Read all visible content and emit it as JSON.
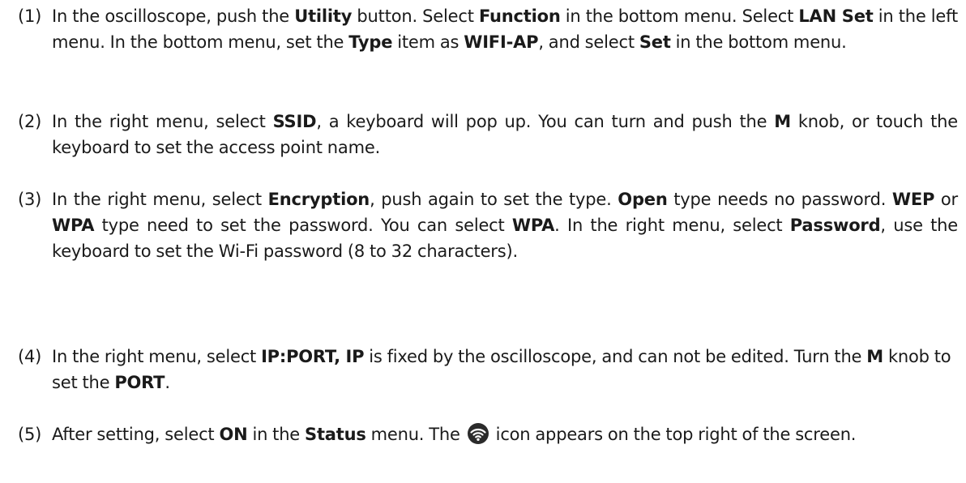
{
  "steps": [
    {
      "num": "(1)",
      "parts": [
        "In the oscilloscope, push the ",
        {
          "b": "Utility"
        },
        " button. Select ",
        {
          "b": "Function"
        },
        " in the bottom menu. Select ",
        {
          "b": "LAN Set"
        },
        " in the left menu. In the bottom menu, set the ",
        {
          "b": "Type"
        },
        " item as ",
        {
          "b": "WIFI-AP"
        },
        ", and select ",
        {
          "b": "Set"
        },
        " in the bottom menu."
      ]
    },
    {
      "num": "(2)",
      "parts": [
        "In the right menu, select ",
        {
          "b": "SSID"
        },
        ", a keyboard will pop up. You can turn and push the ",
        {
          "b": "M"
        },
        " knob, or touch the keyboard to set the access point name."
      ]
    },
    {
      "num": "(3)",
      "parts": [
        "In the right menu, select ",
        {
          "b": "Encryption"
        },
        ", push again to set the type. ",
        {
          "b": "Open"
        },
        " type needs no password. ",
        {
          "b": "WEP"
        },
        " or ",
        {
          "b": "WPA"
        },
        " type need to set the password. You can select ",
        {
          "b": "WPA"
        },
        ". In the right menu, select ",
        {
          "b": "Password"
        },
        ", use the keyboard to set the Wi-Fi password (8 to 32 characters)."
      ]
    },
    {
      "num": "(4)",
      "parts": [
        "In the right menu, select ",
        {
          "b": "IP:PORT, IP"
        },
        " is fixed by the oscilloscope, and can not be edited. Turn the ",
        {
          "b": "M"
        },
        " knob to set the ",
        {
          "b": "PORT"
        },
        "."
      ]
    },
    {
      "num": "(5)",
      "parts": [
        "After setting, select ",
        {
          "b": "ON"
        },
        " in the ",
        {
          "b": "Status"
        },
        " menu. The ",
        {
          "icon": "wifi-icon"
        },
        " icon appears on the top right of the screen."
      ]
    }
  ]
}
